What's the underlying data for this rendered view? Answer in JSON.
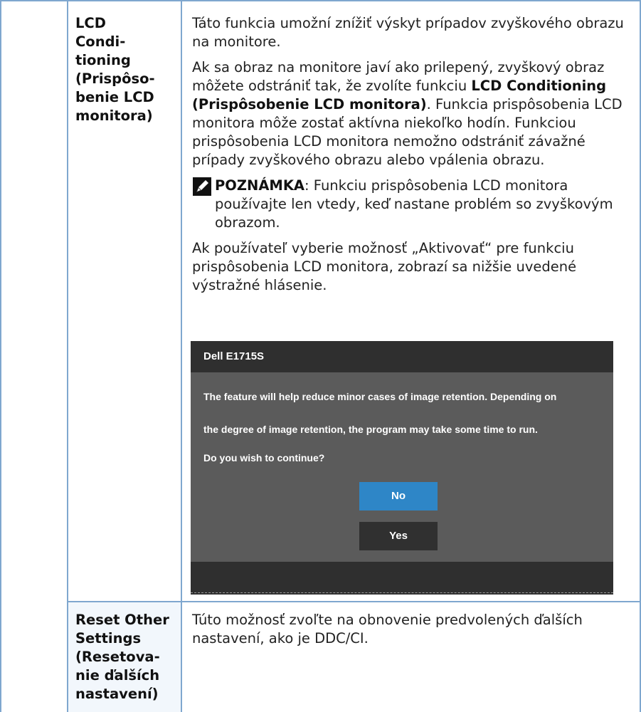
{
  "rows": [
    {
      "label": "LCD\nCondi-\ntioning\n(Prispôso-\nbenie LCD\nmonitora)",
      "para1": "Táto funkcia umožní znížiť výskyt prípadov zvyškového obrazu na monitore.",
      "para2_pre": "Ak sa obraz na monitore javí ako prilepený, zvyškový obraz môžete odstrániť tak, že zvolíte funkciu ",
      "para2_bold": "LCD Conditioning (Prispôsobenie LCD monitora)",
      "para2_post": ". Funkcia prispôsobenia LCD monitora môže zostať aktívna niekoľko hodín. Funkciou prispôsobenia LCD monitora nemožno odstrániť závažné prípady zvyškového obrazu alebo vpálenia obrazu.",
      "note_title": "POZNÁMKA",
      "note_text": ": Funkciu prispôsobenia LCD monitora používajte len vtedy, keď nastane problém so zvyškovým obrazom.",
      "para3": "Ak používateľ vyberie možnosť „Aktivovať“ pre funkciu prispôsobenia LCD monitora, zobrazí sa nižšie uvedené výstražné hlásenie."
    },
    {
      "label": "Reset Other\nSettings\n(Resetova-\nnie ďalších\nnastavení)",
      "text": "Túto možnosť zvoľte na obnovenie predvolených ďalších nastavení, ako je DDC/CI."
    }
  ],
  "dialog": {
    "title": "Dell E1715S",
    "line1": "The feature will help reduce minor cases of image retention. Depending on",
    "line2": "the degree of image retention, the program may take some time to run.",
    "line3": "Do you wish to continue?",
    "no_label": "No",
    "yes_label": "Yes"
  },
  "colors": {
    "border": "#7fa7cf",
    "row_bg": "#f2f7fc",
    "dialog_bg": "#5b5b5b",
    "dialog_header": "#2f2f2f",
    "no_button": "#2e86c7",
    "yes_button": "#303030"
  },
  "icons": {
    "note": "pencil-note-icon"
  }
}
